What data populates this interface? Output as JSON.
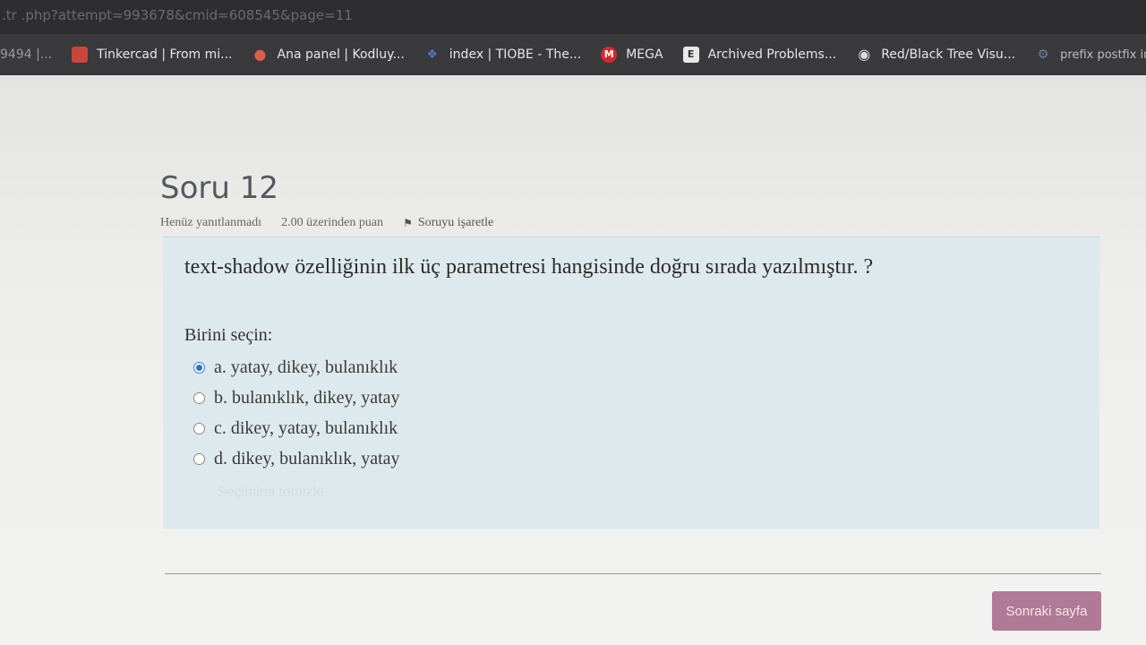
{
  "browser": {
    "url": ".tr                          .php?attempt=993678&cmid=608545&page=11",
    "bookmarks": [
      {
        "label": "9494 |...",
        "icon": "none"
      },
      {
        "label": "Tinkercad | From mi...",
        "icon": "tinkercad-icon",
        "color": "#c9463d"
      },
      {
        "label": "Ana panel | Kodluy...",
        "icon": "map-pin-icon",
        "color": "#d9604b"
      },
      {
        "label": "index | TIOBE - The...",
        "icon": "tiobe-icon",
        "color": "#4a79c8"
      },
      {
        "label": "MEGA",
        "icon": "mega-icon",
        "color": "#d9272e"
      },
      {
        "label": "Archived Problems...",
        "icon": "project-euler-icon",
        "color": "#e8e8e8"
      },
      {
        "label": "Red/Black Tree Visu...",
        "icon": "globe-icon",
        "color": "#dddddd"
      },
      {
        "label": "prefix postfix infix o...",
        "icon": "site-icon",
        "color": "#6b7fa6"
      }
    ]
  },
  "question": {
    "title": "Soru 12",
    "status": "Henüz yanıtlanmadı",
    "points": "2.00 üzerinden puan",
    "flag_label": "Soruyu işaretle",
    "text": "text-shadow özelliğinin ilk üç parametresi hangisinde doğru sırada yazılmıştır. ?",
    "prompt": "Birini seçin:",
    "answers": [
      {
        "label": "a. yatay, dikey, bulanıklık",
        "selected": true
      },
      {
        "label": "b. bulanıklık, dikey, yatay",
        "selected": false
      },
      {
        "label": "c. dikey, yatay, bulanıklık",
        "selected": false
      },
      {
        "label": "d. dikey, bulanıklık, yatay",
        "selected": false
      }
    ],
    "clear_label": "Seçimimi temizle"
  },
  "navigation": {
    "next_label": "Sonraki sayfa"
  },
  "colors": {
    "question_box": "#dde9ed",
    "next_button": "#b07a96"
  }
}
